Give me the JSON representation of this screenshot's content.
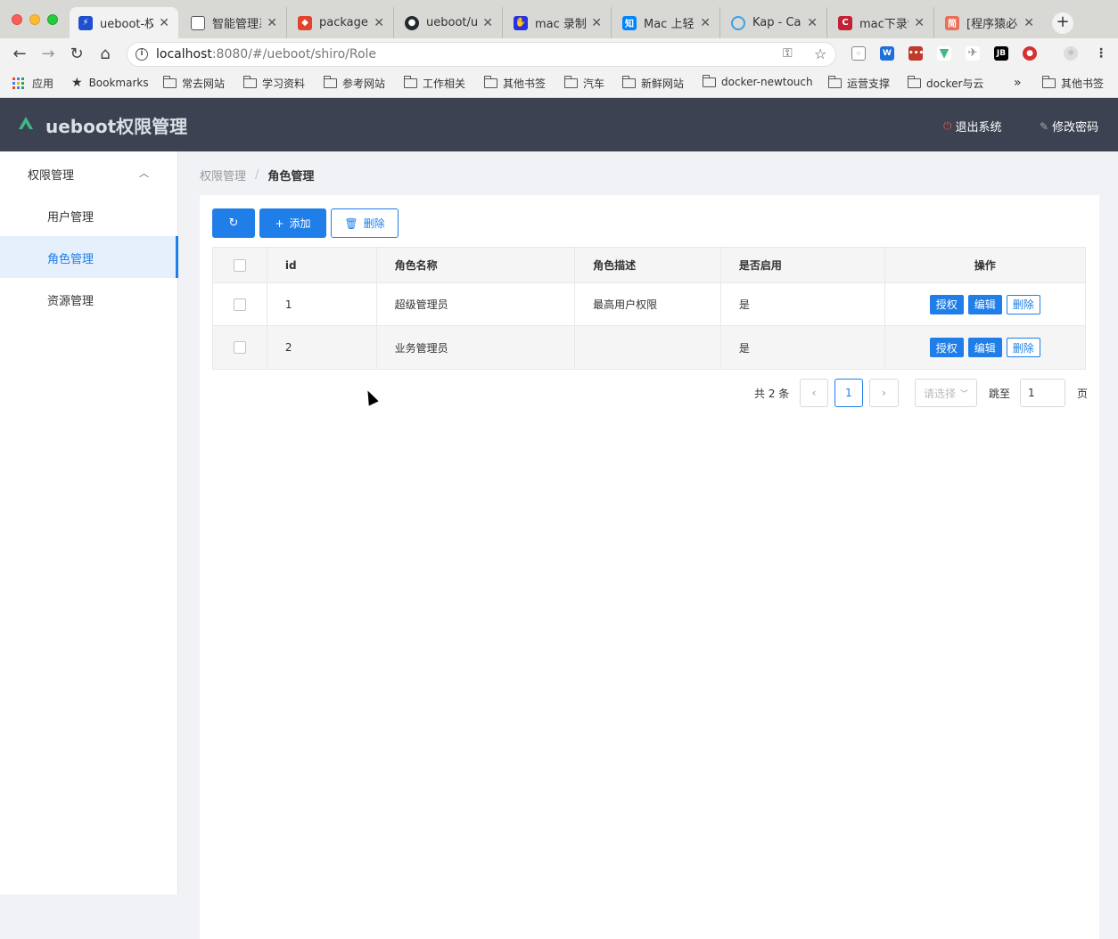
{
  "browser": {
    "tabs": [
      {
        "title": "ueboot-权",
        "favicon": "ueboot-favicon",
        "color": "#2050d0"
      },
      {
        "title": "智能管理系",
        "favicon": "document-favicon",
        "color": "#888888"
      },
      {
        "title": "package.j",
        "favicon": "gitlab-favicon",
        "color": "#e2432a"
      },
      {
        "title": "ueboot/ue",
        "favicon": "github-favicon",
        "color": "#24292e"
      },
      {
        "title": "mac 录制",
        "favicon": "baidu-favicon",
        "color": "#2932e1"
      },
      {
        "title": "Mac 上轻",
        "favicon": "zhihu-favicon",
        "color": "#0084ff"
      },
      {
        "title": "Kap - Cap",
        "favicon": "kap-favicon",
        "color": "#3aa0e8"
      },
      {
        "title": "mac下录制",
        "favicon": "csdn-favicon",
        "color": "#c32136"
      },
      {
        "title": "[程序猿必",
        "favicon": "jianshu-favicon",
        "color": "#ea6f5a"
      }
    ],
    "favicon_glyphs": {
      "zhihu": "知",
      "jianshu": "简",
      "csdn": "C"
    },
    "url_host": "localhost",
    "url_rest": ":8080/#/ueboot/shiro/Role",
    "bookmarks": [
      {
        "label": "应用",
        "type": "apps"
      },
      {
        "label": "Bookmarks",
        "type": "star"
      },
      {
        "label": "常去网站",
        "type": "folder"
      },
      {
        "label": "学习资料",
        "type": "folder"
      },
      {
        "label": "参考网站",
        "type": "folder"
      },
      {
        "label": "工作相关",
        "type": "folder"
      },
      {
        "label": "其他书签",
        "type": "folder"
      },
      {
        "label": "汽车",
        "type": "folder"
      },
      {
        "label": "新鲜网站",
        "type": "folder"
      },
      {
        "label": "docker-newtouch",
        "type": "folder"
      },
      {
        "label": "运营支撑",
        "type": "folder"
      },
      {
        "label": "docker与云",
        "type": "folder"
      },
      {
        "label": "其他书签",
        "type": "folder"
      }
    ],
    "overflow": "»",
    "ext_jb": "JB"
  },
  "header": {
    "title": "ueboot权限管理",
    "logout": "退出系统",
    "change_password": "修改密码"
  },
  "sidebar": {
    "group": "权限管理",
    "items": [
      {
        "label": "用户管理",
        "active": false
      },
      {
        "label": "角色管理",
        "active": true
      },
      {
        "label": "资源管理",
        "active": false
      }
    ]
  },
  "breadcrumb": {
    "parent": "权限管理",
    "separator": "/",
    "current": "角色管理"
  },
  "toolbar": {
    "add_label": "添加",
    "delete_label": "删除"
  },
  "table": {
    "columns": [
      "id",
      "角色名称",
      "角色描述",
      "是否启用",
      "操作"
    ],
    "rows": [
      {
        "id": "1",
        "name": "超级管理员",
        "desc": "最高用户权限",
        "enabled": "是"
      },
      {
        "id": "2",
        "name": "业务管理员",
        "desc": "",
        "enabled": "是"
      }
    ],
    "row_actions": {
      "grant": "授权",
      "edit": "编辑",
      "delete": "删除"
    }
  },
  "pagination": {
    "total_text": "共 2 条",
    "current_page": "1",
    "page_size_placeholder": "请选择",
    "jump_label": "跳至",
    "jump_value": "1",
    "page_suffix": "页"
  },
  "colors": {
    "primary": "#1f7ee8",
    "header_bg": "#3d4252",
    "sidebar_active_bg": "#e6f0fc"
  }
}
